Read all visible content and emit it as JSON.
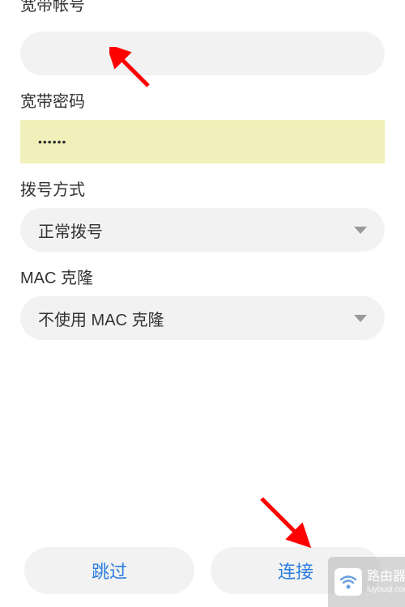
{
  "form": {
    "account_label": "宽带帐号",
    "account_value": "",
    "password_label": "宽带密码",
    "password_display": "••••••",
    "dial_label": "拨号方式",
    "dial_value": "正常拨号",
    "mac_label": "MAC 克隆",
    "mac_value": "不使用 MAC 克隆"
  },
  "buttons": {
    "skip": "跳过",
    "connect": "连接"
  },
  "watermark": {
    "title": "路由器",
    "sub": "luyouqi.com"
  }
}
